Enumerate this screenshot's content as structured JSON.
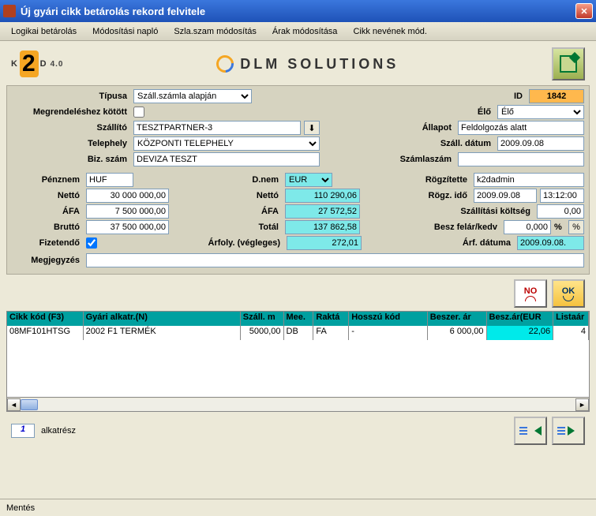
{
  "window": {
    "title": "Új gyári cikk betárolás rekord felvitele"
  },
  "menu": {
    "logikai": "Logikai betárolás",
    "modositasi": "Módosítási napló",
    "szlaszam": "Szla.szam módosítás",
    "arak": "Árak módosítása",
    "cikknev": "Cikk nevének mód."
  },
  "logo": {
    "k": "K",
    "two": "2",
    "d": "D",
    "ver": "4.0",
    "dlm": "DLM SOLUTIONS"
  },
  "form": {
    "tipusa_lbl": "Típusa",
    "tipusa_val": "Száll.számla alapján",
    "id_lbl": "ID",
    "id_val": "1842",
    "megr_lbl": "Megrendeléshez kötött",
    "elo_lbl": "Élő",
    "elo_val": "Élő",
    "szallito_lbl": "Szállító",
    "szallito_val": "TESZTPARTNER-3",
    "allapot_lbl": "Állapot",
    "allapot_val": "Feldolgozás alatt",
    "telephely_lbl": "Telephely",
    "telephely_val": "KÖZPONTI TELEPHELY",
    "szalldatum_lbl": "Száll. dátum",
    "szalldatum_val": "2009.09.08",
    "bizszam_lbl": "Biz. szám",
    "bizszam_val": "DEVIZA TESZT",
    "szamlaszam_lbl": "Számlaszám",
    "penznem_lbl": "Pénznem",
    "penznem_val": "HUF",
    "dnem_lbl": "D.nem",
    "dnem_val": "EUR",
    "rogz_lbl": "Rögzítette",
    "rogz_val": "k2dadmin",
    "netto_lbl": "Nettó",
    "netto_val": "30 000 000,00",
    "netto2_lbl": "Nettó",
    "netto2_val": "110 290,06",
    "rogzido_lbl": "Rögz. idő",
    "rogzido_date": "2009.09.08",
    "rogzido_time": "13:12:00",
    "afa_lbl": "ÁFA",
    "afa_val": "7 500 000,00",
    "afa2_lbl": "ÁFA",
    "afa2_val": "27 572,52",
    "szallkolt_lbl": "Szállítási költség",
    "szallkolt_val": "0,00",
    "brutto_lbl": "Bruttó",
    "brutto_val": "37 500 000,00",
    "total_lbl": "Totál",
    "total_val": "137 862,58",
    "beszfelar_lbl": "Besz felár/kedv",
    "beszfelar_val": "0,000",
    "percent": "%",
    "fizetendo_lbl": "Fizetendő",
    "arfoly_lbl": "Árfoly. (végleges)",
    "arfoly_val": "272,01",
    "arfdatum_lbl": "Árf. dátuma",
    "arfdatum_val": "2009.09.08.",
    "megjegyzes_lbl": "Megjegyzés"
  },
  "buttons": {
    "no": "NO",
    "ok": "OK"
  },
  "grid": {
    "cols": {
      "cikk": "Cikk kód (F3)",
      "nev": "Gyári alkatr.(N)",
      "szall": "Száll. m",
      "mee": "Mee.",
      "rakt": "Raktá",
      "hosszu": "Hosszú kód",
      "besz": "Beszer. ár",
      "eur": "Besz.ár(EUR",
      "list": "Listaár"
    },
    "row": {
      "cikk": "08MF101HTSG",
      "nev": "2002 F1 TERMÉK",
      "szall": "5000,00",
      "mee": "DB",
      "rakt": "FA",
      "hosszu": "-",
      "besz": "6 000,00",
      "eur": "22,06",
      "list": "4"
    }
  },
  "footer": {
    "count": "1",
    "label": "alkatrész"
  },
  "status": {
    "text": "Mentés"
  }
}
